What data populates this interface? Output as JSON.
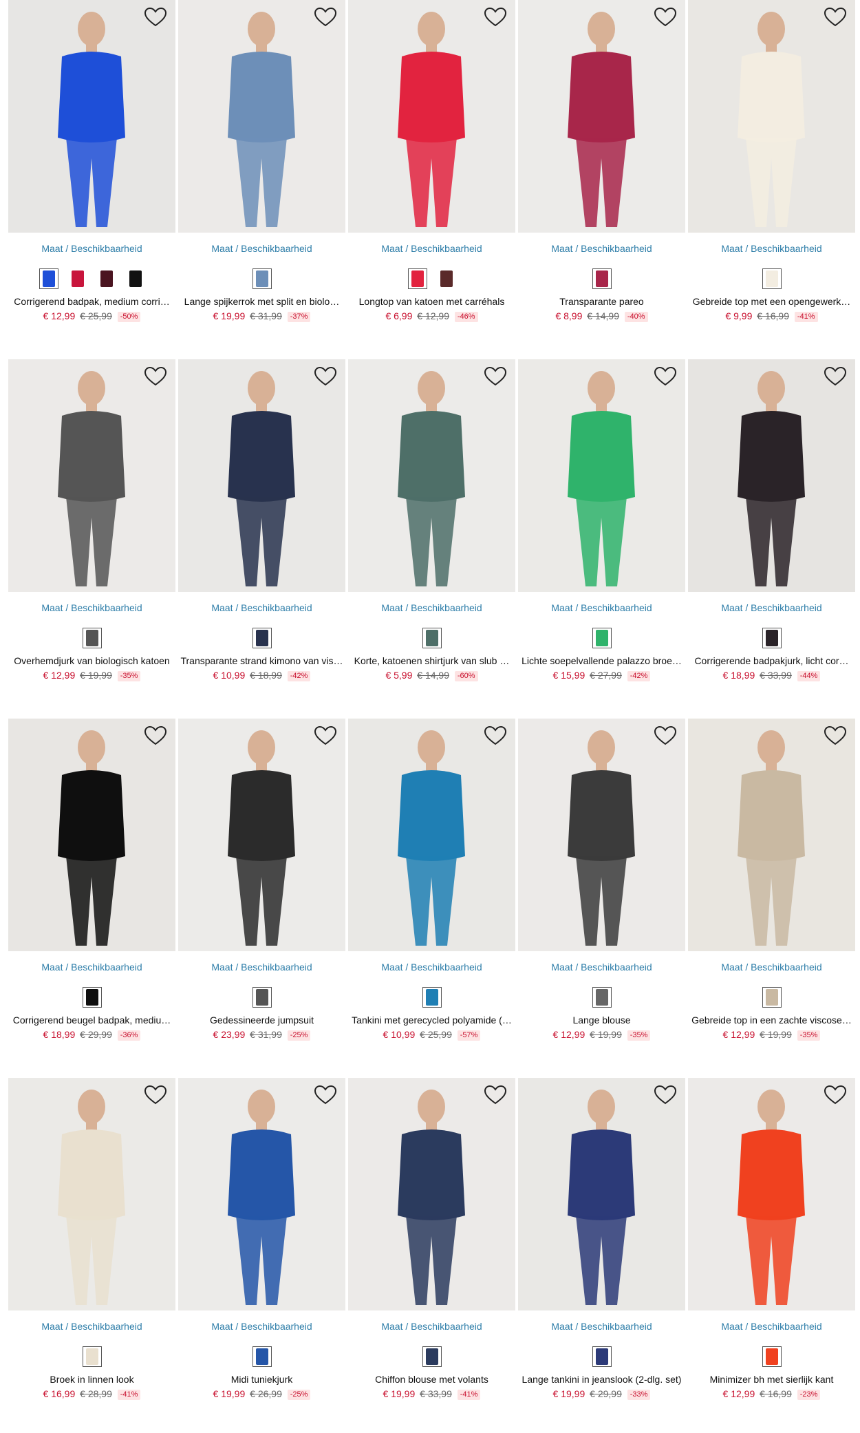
{
  "size_label": "Maat / Beschikbaarheid",
  "products": [
    {
      "title": "Corrigerend badpak, medium corri…",
      "price": "€ 12,99",
      "old_price": "€ 25,99",
      "discount": "-50%",
      "bg": "#e7e6e4",
      "garment": "#1e4fd8",
      "swatches": [
        "#1e4fd8",
        "#c8153c",
        "#4a1420",
        "#111111"
      ]
    },
    {
      "title": "Lange spijkerrok met split en biolo…",
      "price": "€ 19,99",
      "old_price": "€ 31,99",
      "discount": "-37%",
      "bg": "#eceae8",
      "garment": "#6d8fb8",
      "swatches": [
        "#6d8fb8"
      ]
    },
    {
      "title": "Longtop van katoen met carréhals",
      "price": "€ 6,99",
      "old_price": "€ 12,99",
      "discount": "-46%",
      "bg": "#ebeae8",
      "garment": "#e2233f",
      "swatches": [
        "#e2233f",
        "#5a2a2a"
      ]
    },
    {
      "title": "Transparante pareo",
      "price": "€ 8,99",
      "old_price": "€ 14,99",
      "discount": "-40%",
      "bg": "#ecebe9",
      "garment": "#a8264a",
      "swatches": [
        "#a8264a"
      ]
    },
    {
      "title": "Gebreide top met een opengewerk…",
      "price": "€ 9,99",
      "old_price": "€ 16,99",
      "discount": "-41%",
      "bg": "#e9e7e3",
      "garment": "#f3ede1",
      "swatches": [
        "#f3ede1"
      ]
    },
    {
      "title": "Overhemdjurk van biologisch katoen",
      "price": "€ 12,99",
      "old_price": "€ 19,99",
      "discount": "-35%",
      "bg": "#eceae8",
      "garment": "#555555",
      "swatches": [
        "#555555"
      ]
    },
    {
      "title": "Transparante strand kimono van vis…",
      "price": "€ 10,99",
      "old_price": "€ 18,99",
      "discount": "-42%",
      "bg": "#e9e8e6",
      "garment": "#28324e",
      "swatches": [
        "#28324e"
      ]
    },
    {
      "title": "Korte, katoenen shirtjurk van slub …",
      "price": "€ 5,99",
      "old_price": "€ 14,99",
      "discount": "-60%",
      "bg": "#ecebe9",
      "garment": "#4e6f68",
      "swatches": [
        "#4e6f68"
      ]
    },
    {
      "title": "Lichte soepelvallende palazzo broe…",
      "price": "€ 15,99",
      "old_price": "€ 27,99",
      "discount": "-42%",
      "bg": "#ebeae7",
      "garment": "#2fb36b",
      "swatches": [
        "#2fb36b"
      ]
    },
    {
      "title": "Corrigerende badpakjurk, licht cor…",
      "price": "€ 18,99",
      "old_price": "€ 33,99",
      "discount": "-44%",
      "bg": "#e6e4e1",
      "garment": "#2a2328",
      "swatches": [
        "#2a2328"
      ]
    },
    {
      "title": "Corrigerend beugel badpak, mediu…",
      "price": "€ 18,99",
      "old_price": "€ 29,99",
      "discount": "-36%",
      "bg": "#e8e6e3",
      "garment": "#0f0f0f",
      "swatches": [
        "#0f0f0f"
      ]
    },
    {
      "title": "Gedessineerde jumpsuit",
      "price": "€ 23,99",
      "old_price": "€ 31,99",
      "discount": "-25%",
      "bg": "#ecebe9",
      "garment": "#2b2b2b",
      "swatches": [
        "#555555"
      ]
    },
    {
      "title": "Tankini met gerecycled polyamide (…",
      "price": "€ 10,99",
      "old_price": "€ 25,99",
      "discount": "-57%",
      "bg": "#e9e8e5",
      "garment": "#1f7fb4",
      "swatches": [
        "#1f7fb4"
      ]
    },
    {
      "title": "Lange blouse",
      "price": "€ 12,99",
      "old_price": "€ 19,99",
      "discount": "-35%",
      "bg": "#eceae8",
      "garment": "#3b3b3b",
      "swatches": [
        "#666666"
      ]
    },
    {
      "title": "Gebreide top in een zachte viscose…",
      "price": "€ 12,99",
      "old_price": "€ 19,99",
      "discount": "-35%",
      "bg": "#e9e6e0",
      "garment": "#c9b9a2",
      "swatches": [
        "#c9b9a2"
      ]
    },
    {
      "title": "Broek in linnen look",
      "price": "€ 16,99",
      "old_price": "€ 28,99",
      "discount": "-41%",
      "bg": "#ebeae7",
      "garment": "#e9e0cf",
      "swatches": [
        "#e9e0cf"
      ]
    },
    {
      "title": "Midi tuniekjurk",
      "price": "€ 19,99",
      "old_price": "€ 26,99",
      "discount": "-25%",
      "bg": "#ecebe9",
      "garment": "#2556a8",
      "swatches": [
        "#2556a8"
      ]
    },
    {
      "title": "Chiffon blouse met volants",
      "price": "€ 19,99",
      "old_price": "€ 33,99",
      "discount": "-41%",
      "bg": "#eceae8",
      "garment": "#2b3b5e",
      "swatches": [
        "#2b3b5e"
      ]
    },
    {
      "title": "Lange tankini in jeanslook (2-dlg. set)",
      "price": "€ 19,99",
      "old_price": "€ 29,99",
      "discount": "-33%",
      "bg": "#e9e8e5",
      "garment": "#2c3a78",
      "swatches": [
        "#2c3a78"
      ]
    },
    {
      "title": "Minimizer bh met sierlijk kant",
      "price": "€ 12,99",
      "old_price": "€ 16,99",
      "discount": "-23%",
      "bg": "#eceae8",
      "garment": "#f0411f",
      "swatches": [
        "#f0411f"
      ]
    }
  ]
}
